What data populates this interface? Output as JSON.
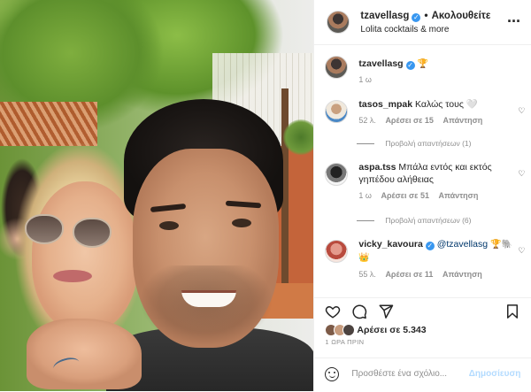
{
  "header": {
    "username": "tzavellasg",
    "separator": "•",
    "follow_label": "Ακολουθείτε",
    "subtitle": "Lolita cocktails & more",
    "more_icon": "more-horizontal-icon"
  },
  "caption": {
    "username": "tzavellasg",
    "emoji": "🏆",
    "time": "1 ω"
  },
  "comments": [
    {
      "username": "tasos_mpak",
      "text": "Καλώς τους 🤍",
      "time": "52 λ.",
      "likes": "Αρέσει σε 15",
      "reply": "Απάντηση",
      "view_replies": "Προβολή απαντήσεων (1)"
    },
    {
      "username": "aspa.tss",
      "text": "Μπάλα εντός και εκτός γηπέδου αλήθειας",
      "time": "1 ω",
      "likes": "Αρέσει σε 51",
      "reply": "Απάντηση",
      "view_replies": "Προβολή απαντήσεων (6)"
    },
    {
      "username": "vicky_kavoura",
      "mention": "@tzavellasg",
      "emojis": "🏆🐘",
      "emoji2": "👑",
      "time": "55 λ.",
      "likes": "Αρέσει σε 11",
      "reply": "Απάντηση"
    }
  ],
  "actions": {
    "like_icon": "heart-icon",
    "comment_icon": "comment-icon",
    "share_icon": "share-icon",
    "save_icon": "bookmark-icon"
  },
  "likes_text": "Αρέσει σε 5.343",
  "posted_ago": "1 ΩΡΑ ΠΡΙΝ",
  "comment_box": {
    "placeholder": "Προσθέστε ένα σχόλιο...",
    "post_label": "Δημοσίευση"
  },
  "colors": {
    "verified": "#3897f0",
    "muted": "#8e8e8e",
    "post_button": "#b3dbff",
    "mention": "#00376b"
  }
}
